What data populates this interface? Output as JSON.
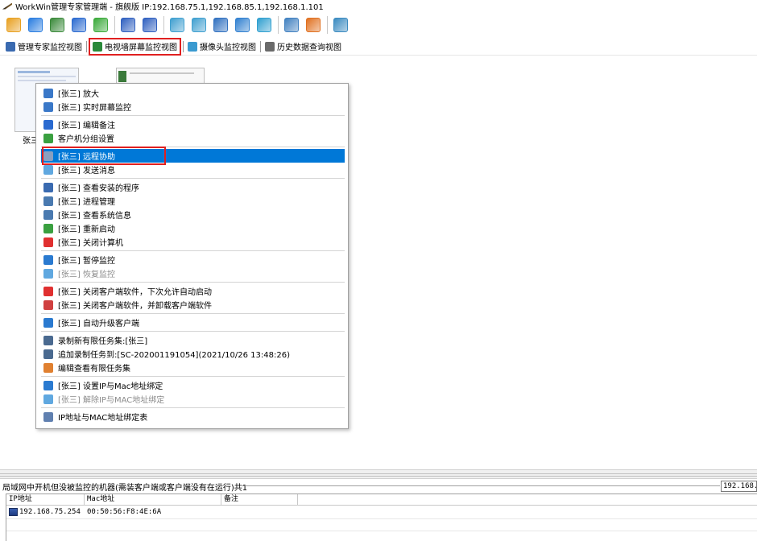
{
  "window": {
    "title": "WorkWin管理专家管理端 - 旗舰版 IP:192.168.75.1,192.168.85.1,192.168.1.101",
    "app_icon": "workwin-logo-icon"
  },
  "toolbar": {
    "buttons": [
      {
        "icon": "stack-icon",
        "color": "#e8a020"
      },
      {
        "icon": "globe-icon",
        "color": "#2a7de0"
      },
      {
        "icon": "settings-gear-icon",
        "color": "#3a8a3a"
      },
      {
        "icon": "document-check-icon",
        "color": "#2a6ad0"
      },
      {
        "icon": "users-group-icon",
        "color": "#3aaa3a"
      },
      {
        "icon": "org-chart-icon",
        "color": "#3060c0"
      },
      {
        "icon": "user-lock-icon",
        "color": "#3060c0"
      },
      {
        "icon": "screen-share-icon",
        "color": "#40a0d0"
      },
      {
        "icon": "broadcast-icon",
        "color": "#40a0d0"
      },
      {
        "icon": "search-screen-icon",
        "color": "#3070c0"
      },
      {
        "icon": "screen-transfer-icon",
        "color": "#3080d0"
      },
      {
        "icon": "picture-monitor-icon",
        "color": "#30a0d0"
      },
      {
        "icon": "ip-window-icon",
        "color": "#4080c0"
      },
      {
        "icon": "report-icon",
        "color": "#e07020"
      },
      {
        "icon": "chat-bubble-icon",
        "color": "#3a8ac0"
      }
    ]
  },
  "view_tabs": [
    {
      "label": "管理专家监控视图",
      "icon": "manager-view-icon",
      "active": false
    },
    {
      "label": "电视墙屏幕监控视图",
      "icon": "tv-wall-icon",
      "active": true
    },
    {
      "label": "摄像头监控视图",
      "icon": "camera-view-icon",
      "active": false
    },
    {
      "label": "历史数据查询视图",
      "icon": "history-query-icon",
      "active": false
    }
  ],
  "monitor": {
    "thumb_label": "张三"
  },
  "context_menu": {
    "items": [
      {
        "label": "[张三] 放大",
        "icon": "zoom-monitor-icon",
        "color": "#3a78c8",
        "state": "normal"
      },
      {
        "label": "[张三] 实时屏幕监控",
        "icon": "magnifier-icon",
        "color": "#3a78c8",
        "state": "normal"
      },
      {
        "sep": true
      },
      {
        "label": "[张三] 编辑备注",
        "icon": "pencil-icon",
        "color": "#2a6ad0",
        "state": "normal"
      },
      {
        "label": "客户机分组设置",
        "icon": "client-group-icon",
        "color": "#3aa040",
        "state": "normal"
      },
      {
        "sep": true
      },
      {
        "label": "[张三] 远程协助",
        "icon": "remote-assist-icon",
        "color": "#8aa0c0",
        "state": "selected"
      },
      {
        "label": "[张三] 发送消息",
        "icon": "send-message-icon",
        "color": "#60a8e0",
        "state": "normal"
      },
      {
        "sep": true
      },
      {
        "label": "[张三] 查看安装的程序",
        "icon": "installed-programs-icon",
        "color": "#3a6ab0",
        "state": "normal"
      },
      {
        "label": "[张三] 进程管理",
        "icon": "process-icon",
        "color": "#4a7ab0",
        "state": "normal"
      },
      {
        "label": "[张三] 查看系统信息",
        "icon": "system-info-icon",
        "color": "#4a7ab0",
        "state": "normal"
      },
      {
        "label": "[张三] 重新启动",
        "icon": "restart-icon",
        "color": "#3aa040",
        "state": "normal"
      },
      {
        "label": "[张三] 关闭计算机",
        "icon": "power-icon",
        "color": "#e03030",
        "state": "normal"
      },
      {
        "sep": true
      },
      {
        "label": "[张三] 暂停监控",
        "icon": "pause-icon",
        "color": "#2a7ad0",
        "state": "normal"
      },
      {
        "label": "[张三] 恢复监控",
        "icon": "play-icon",
        "color": "#60a8e0",
        "state": "disabled"
      },
      {
        "sep": true
      },
      {
        "label": "[张三] 关闭客户端软件，下次允许自动启动",
        "icon": "close-x-icon",
        "color": "#e03030",
        "state": "normal"
      },
      {
        "label": "[张三] 关闭客户端软件，并卸载客户端软件",
        "icon": "uninstall-icon",
        "color": "#d04040",
        "state": "normal"
      },
      {
        "sep": true
      },
      {
        "label": "[张三] 自动升级客户端",
        "icon": "upgrade-arrow-icon",
        "color": "#2a7ad0",
        "state": "normal"
      },
      {
        "sep": true
      },
      {
        "label": "录制新有限任务集:[张三]",
        "icon": "record-task-icon",
        "color": "#4a6a90",
        "state": "normal"
      },
      {
        "label": "追加录制任务到:[SC-202001191054](2021/10/26 13:48:26)",
        "icon": "append-task-icon",
        "color": "#4a6a90",
        "state": "normal"
      },
      {
        "label": "编辑查看有限任务集",
        "icon": "edit-task-icon",
        "color": "#e08030",
        "state": "normal"
      },
      {
        "sep": true
      },
      {
        "label": "[张三] 设置IP与Mac地址绑定",
        "icon": "lock-bind-icon",
        "color": "#2a7ad0",
        "state": "normal"
      },
      {
        "label": "[张三] 解除IP与MAC地址绑定",
        "icon": "unbind-icon",
        "color": "#60a8e0",
        "state": "disabled"
      },
      {
        "sep": true
      },
      {
        "label": "IP地址与MAC地址绑定表",
        "icon": "bind-table-icon",
        "color": "#6080b0",
        "state": "normal"
      }
    ]
  },
  "bottom": {
    "caption": "局域网中开机但没被监控的机器(需装客户端或客户端没有在运行)共1",
    "ip_value": "192.168.",
    "columns": [
      "IP地址",
      "Mac地址",
      "备注"
    ],
    "rows": [
      {
        "ip": "192.168.75.254",
        "mac": "00:50:56:F8:4E:6A",
        "note": "",
        "icon": "computer-icon"
      }
    ]
  },
  "colors": {
    "accent_selected": "#0078d7",
    "highlight_red": "#e02020"
  }
}
